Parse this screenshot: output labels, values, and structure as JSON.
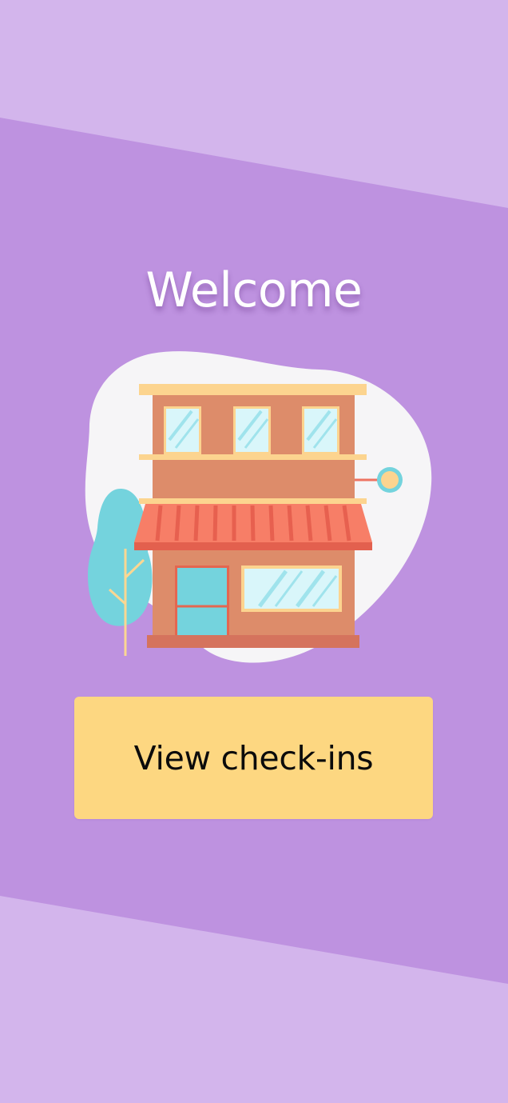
{
  "colors": {
    "background_light": "#D3B5EC",
    "background_band": "#BE92E0",
    "button": "#FDD781",
    "title_text": "#FFFFFF",
    "button_text": "#0B0B0B"
  },
  "header": {
    "title": "Welcome"
  },
  "illustration": {
    "icon": "storefront-illustration"
  },
  "actions": {
    "view_checkins_label": "View check-ins"
  }
}
